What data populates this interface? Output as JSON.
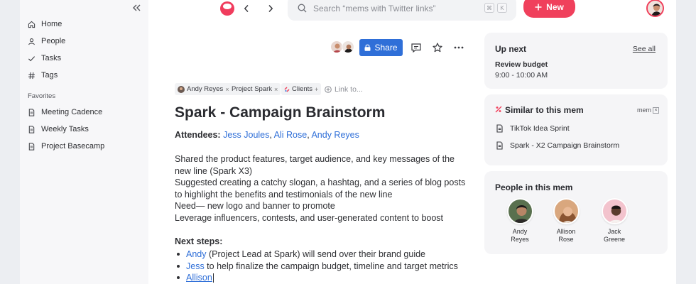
{
  "sidebar": {
    "nav": [
      {
        "label": "Home",
        "icon": "home-icon"
      },
      {
        "label": "People",
        "icon": "person-icon"
      },
      {
        "label": "Tasks",
        "icon": "check-icon"
      },
      {
        "label": "Tags",
        "icon": "hash-icon"
      }
    ],
    "favorites_heading": "Favorites",
    "favorites": [
      {
        "label": "Meeting Cadence",
        "icon": "document-icon"
      },
      {
        "label": "Weekly Tasks",
        "icon": "document-icon"
      },
      {
        "label": "Project Basecamp",
        "icon": "document-icon"
      }
    ]
  },
  "topbar": {
    "search_placeholder": "Search “mems with Twitter links”",
    "kbd_1": "⌘",
    "kbd_2": "K",
    "new_label": "New"
  },
  "doc": {
    "share_label": "Share",
    "tags": [
      {
        "label": "Andy Reyes"
      },
      {
        "label": "Project Spark"
      },
      {
        "label": "Clients"
      }
    ],
    "link_to": "Link to...",
    "title": "Spark - Campaign Brainstorm",
    "attendees_label": "Attendees:",
    "attendees": [
      "Jess Joules",
      "Ali Rose",
      "Andy Reyes"
    ],
    "paragraph": [
      "Shared the product features, target audience, and key messages of the",
      "new line (Spark X3)",
      "Suggested creating a catchy slogan, a hashtag, and a series of blog posts",
      "to highlight the benefits and testimonials of the new line",
      "Need— new logo and banner to promote",
      "Leverage influencers, contests, and user-generated content to boost"
    ],
    "next_steps_label": "Next steps:",
    "steps": [
      {
        "link": "Andy",
        "text": " (Project Lead at Spark) will send over their brand guide"
      },
      {
        "link": "Jess",
        "text": " to help finalize the campaign budget, timeline and target metrics"
      },
      {
        "link": "Allison",
        "text": ""
      }
    ]
  },
  "up_next": {
    "title": "Up next",
    "see_all": "See all",
    "event_title": "Review budget",
    "event_time": "9:00 - 10:00 AM"
  },
  "similar": {
    "title": "Similar to this mem",
    "badge": "mem",
    "items": [
      "TikTok Idea Sprint",
      "Spark - X2 Campaign Brainstorm"
    ]
  },
  "people": {
    "title": "People in this mem",
    "list": [
      {
        "first": "Andy",
        "last": "Reyes"
      },
      {
        "first": "Allison",
        "last": "Rose"
      },
      {
        "first": "Jack",
        "last": "Greene"
      }
    ]
  },
  "colors": {
    "accent": "#f0405c",
    "link": "#2f6fd8"
  }
}
